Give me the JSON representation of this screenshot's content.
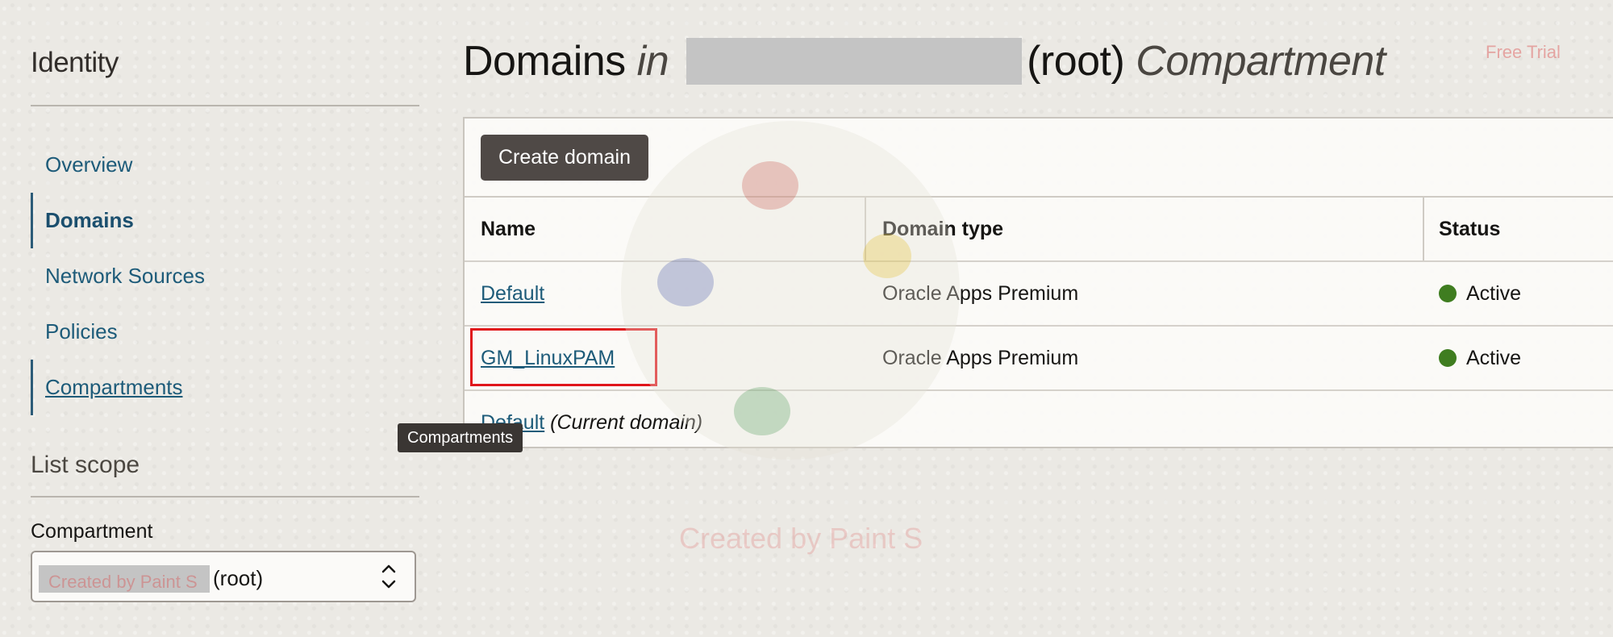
{
  "sidebar": {
    "title": "Identity",
    "items": [
      {
        "label": "Overview"
      },
      {
        "label": "Domains"
      },
      {
        "label": "Network Sources"
      },
      {
        "label": "Policies"
      },
      {
        "label": "Compartments"
      }
    ],
    "list_scope_title": "List scope",
    "compartment_label": "Compartment",
    "compartment_select": {
      "redacted_overlay": "Created by Paint S",
      "value_suffix": "(root)"
    }
  },
  "tooltip": "Compartments",
  "header": {
    "title_prefix": "Domains",
    "title_in": "in",
    "title_root": "(root)",
    "title_suffix": "Compartment",
    "free_trial": "Free Trial"
  },
  "toolbar": {
    "create_label": "Create domain"
  },
  "table": {
    "columns": [
      "Name",
      "Domain type",
      "Status"
    ],
    "rows": [
      {
        "name": "Default",
        "type": "Oracle Apps Premium",
        "status": "Active"
      },
      {
        "name": "GM_LinuxPAM",
        "type": "Oracle Apps Premium",
        "status": "Active"
      }
    ],
    "footer": {
      "name": "Default",
      "note": "(Current domain)"
    }
  },
  "watermark": "Created by Paint S",
  "colors": {
    "link": "#1d5b79",
    "active_status": "#3f7d20",
    "highlight": "#e0161b",
    "button_bg": "#4f4946"
  }
}
